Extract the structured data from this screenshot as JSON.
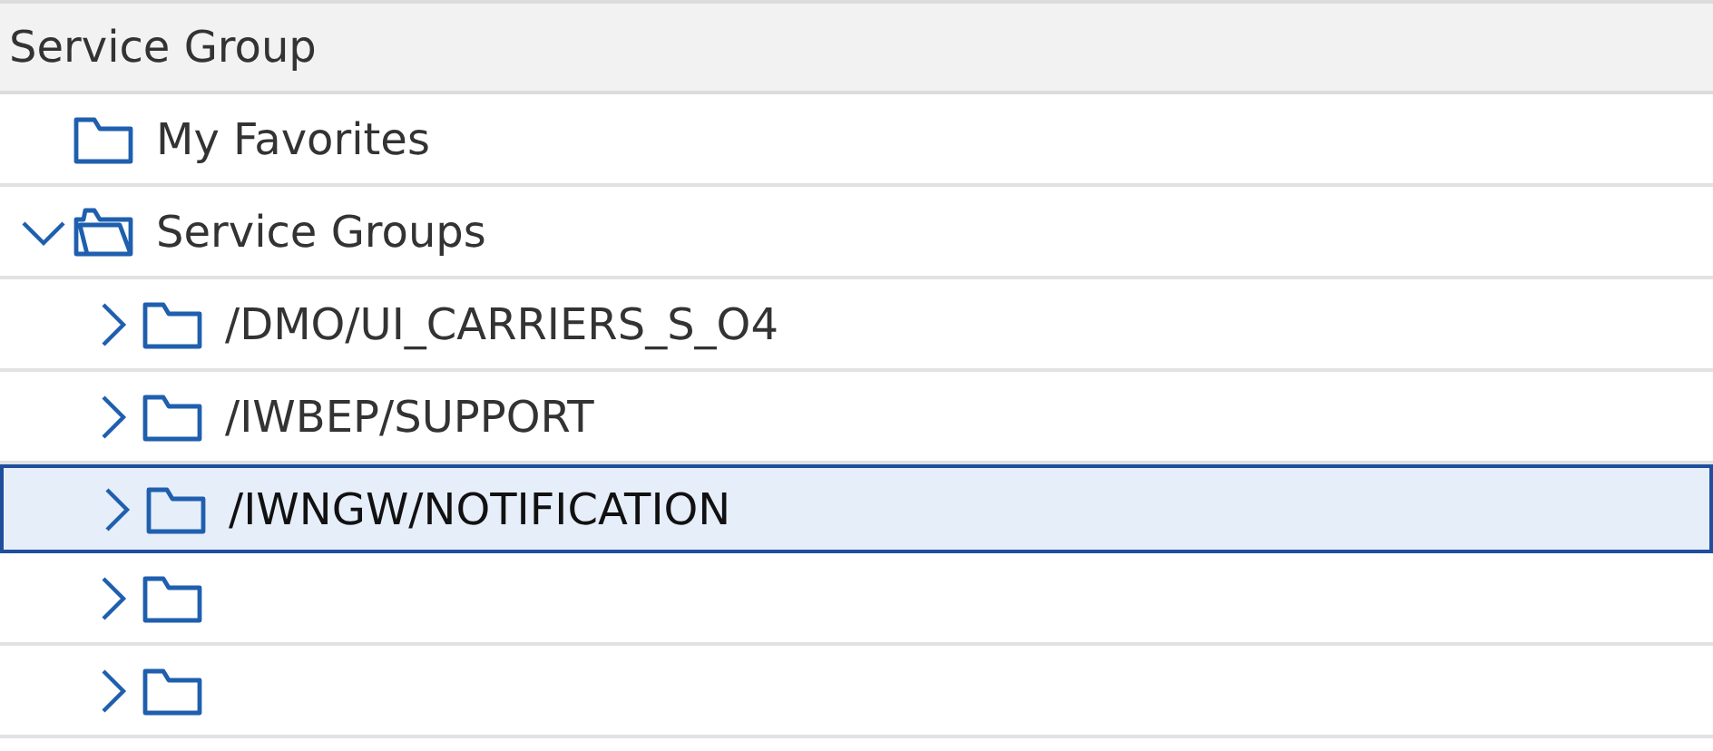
{
  "header": {
    "title": "Service Group"
  },
  "tree": [
    {
      "label": "My Favorites",
      "selected": false
    },
    {
      "label": "Service Groups",
      "selected": false,
      "expanded": true,
      "children": [
        {
          "label": "/DMO/UI_CARRIERS_S_O4",
          "selected": false,
          "expanded": false
        },
        {
          "label": "/IWBEP/SUPPORT",
          "selected": false,
          "expanded": false
        },
        {
          "label": "/IWNGW/NOTIFICATION",
          "selected": true,
          "expanded": false
        },
        {
          "selected": false,
          "expanded": false
        },
        {
          "selected": false,
          "expanded": false
        }
      ]
    }
  ]
}
